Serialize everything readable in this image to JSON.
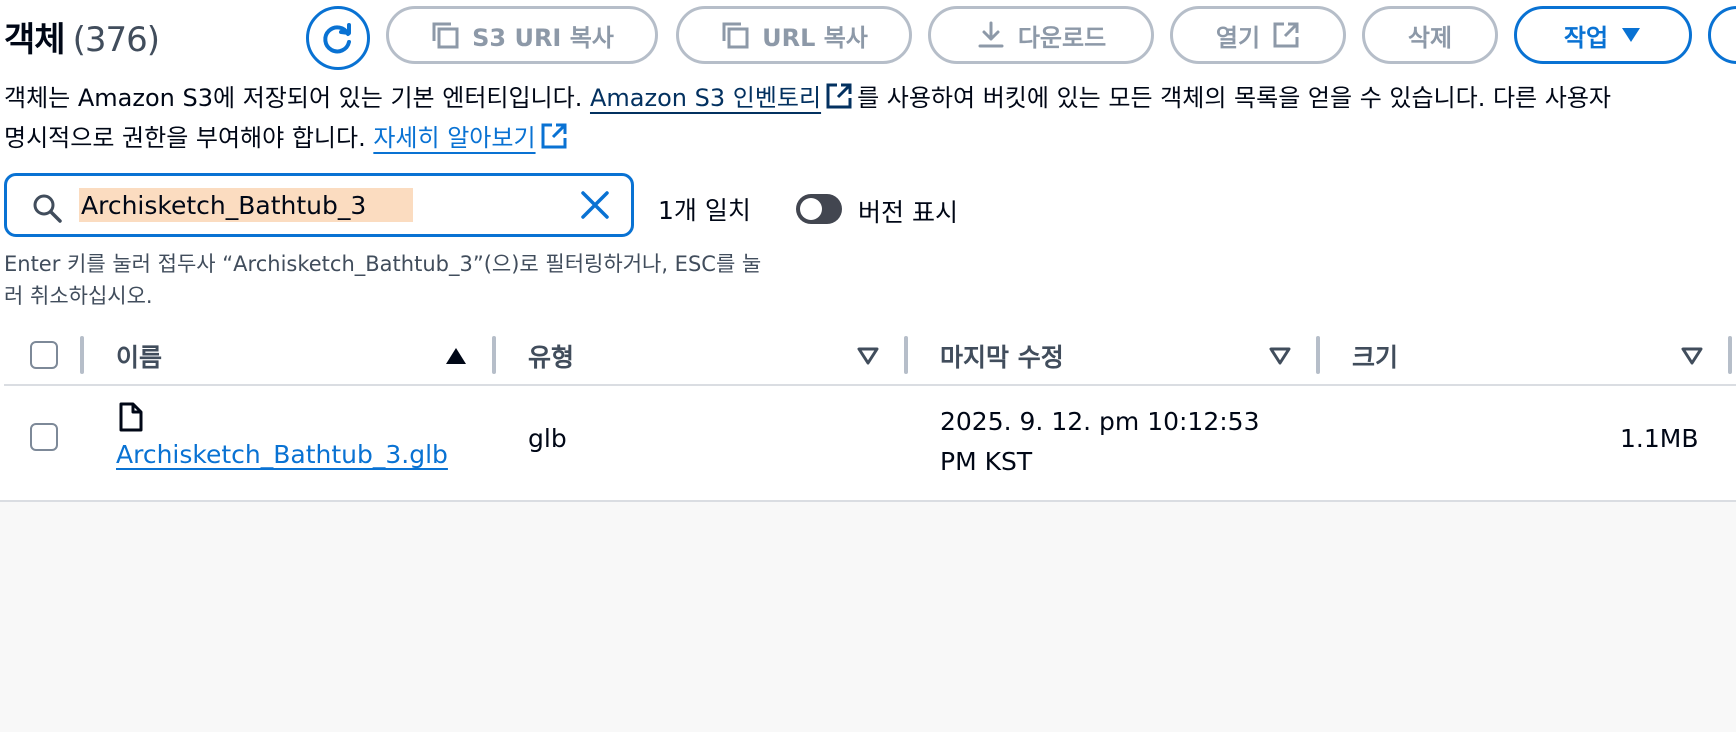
{
  "header": {
    "title": "객체",
    "count": "(376)"
  },
  "toolbar": {
    "s3_uri_copy": "S3 URI 복사",
    "url_copy": "URL 복사",
    "download": "다운로드",
    "open": "열기",
    "delete": "삭제",
    "actions": "작업"
  },
  "description": {
    "part1": "객체는 Amazon S3에 저장되어 있는 기본 엔터티입니다. ",
    "inventory_link": "Amazon S3 인벤토리",
    "part2": "를 사용하여 버킷에 있는 모든 객체의 목록을 얻을 수 있습니다. 다른 사용자",
    "part3": "명시적으로 권한을 부여해야 합니다. ",
    "learn_more_link": "자세히 알아보기"
  },
  "search": {
    "value": "Archisketch_Bathtub_3",
    "match_count": "1개 일치",
    "version_toggle_label": "버전 표시",
    "hint": "Enter 키를 눌러 접두사 “Archisketch_Bathtub_3”(으)로 필터링하거나, ESC를 눌러 취소하십시오."
  },
  "table": {
    "columns": [
      "이름",
      "유형",
      "마지막 수정",
      "크기"
    ],
    "rows": [
      {
        "name": "Archisketch_Bathtub_3.glb",
        "type": "glb",
        "modified_line1": "2025. 9. 12. pm 10:12:53",
        "modified_line2": "PM KST",
        "size": "1.1MB"
      }
    ]
  },
  "icons": {
    "refresh": "refresh-icon",
    "copy": "copy-icon",
    "download": "download-icon",
    "external": "external-link-icon",
    "caret": "caret-down-icon",
    "search": "search-icon",
    "clear": "close-icon",
    "file": "file-icon",
    "sort_asc": "sort-ascending-icon",
    "sort": "sort-icon"
  },
  "colors": {
    "accent": "#0972d3",
    "disabled": "#8d99a8",
    "search_highlight": "#fbdcc0"
  }
}
